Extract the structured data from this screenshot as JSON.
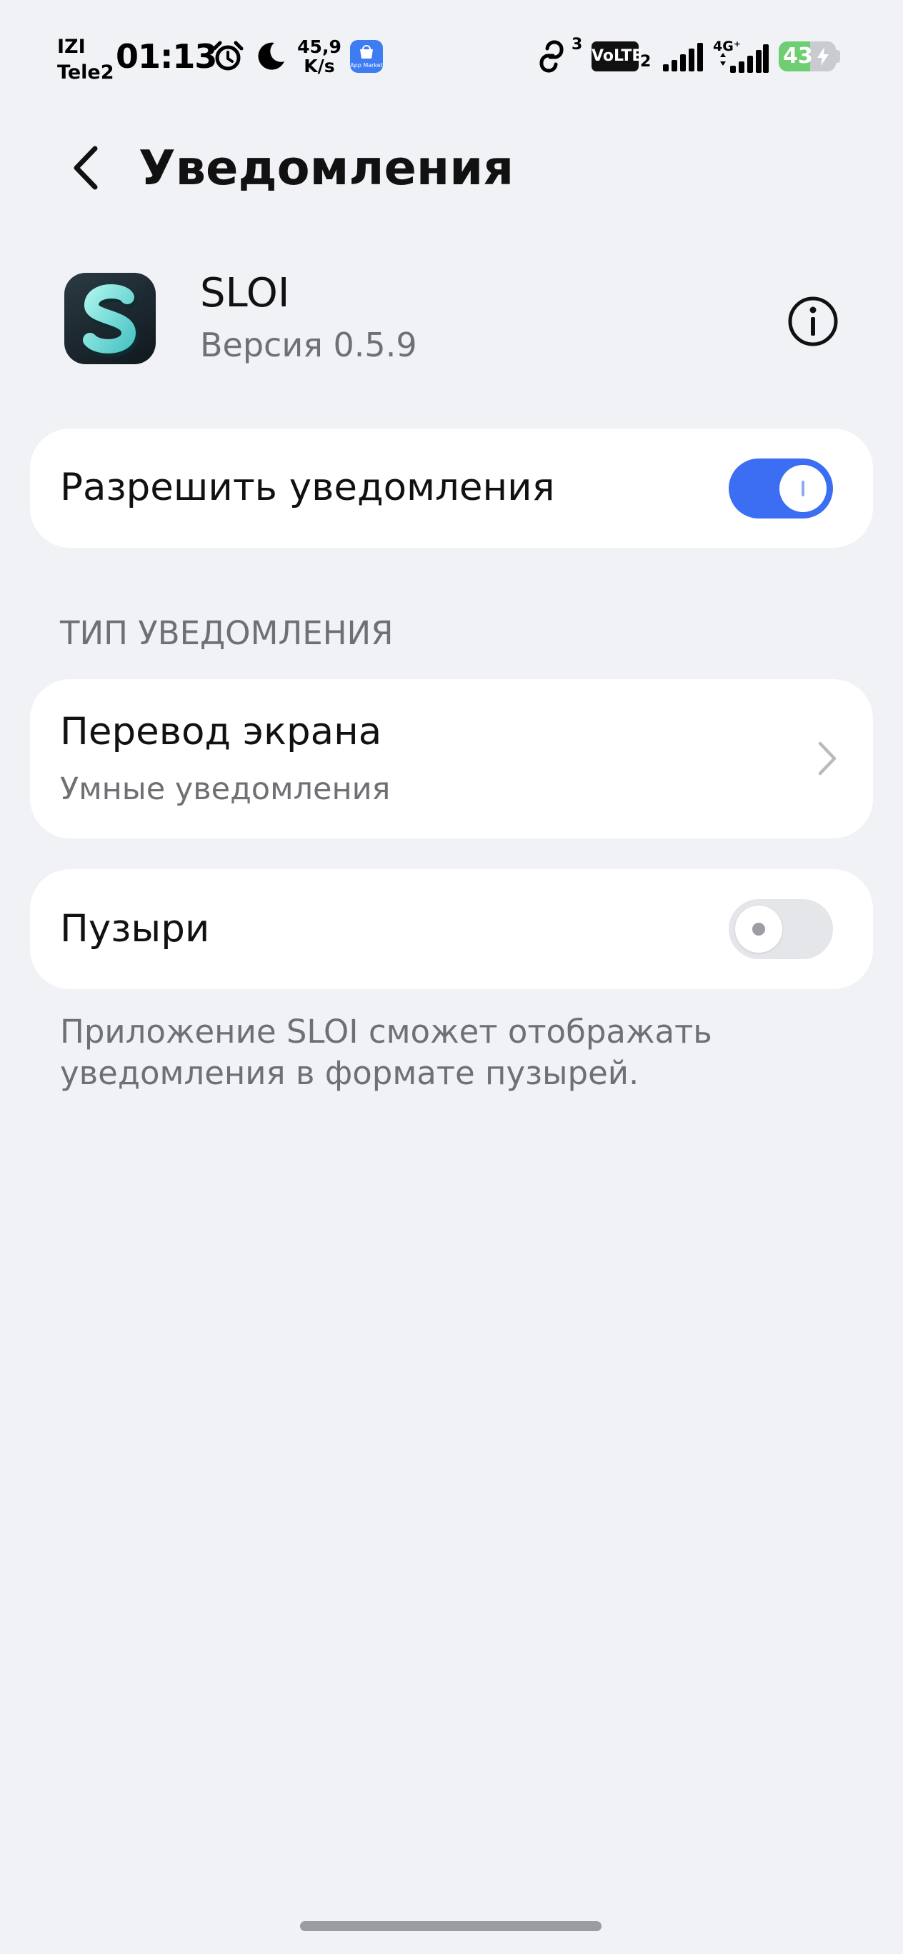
{
  "status_bar": {
    "carrier_top": "IZI",
    "carrier_bottom": "Tele2",
    "time": "01:13",
    "speed_value": "45,9",
    "speed_unit": "K/s",
    "app_market_label": "App Market",
    "sim_number": "3",
    "volte": "VoLTE",
    "volte_sim": "2",
    "network": "4G⁺",
    "battery": "43",
    "icons": [
      "alarm-icon",
      "moon-icon",
      "app-market-icon",
      "hotspot-icon",
      "volte-icon",
      "signal-icon",
      "signal-4g-icon",
      "battery-icon"
    ]
  },
  "header": {
    "title": "Уведомления",
    "back_icon": "chevron-left-icon"
  },
  "app": {
    "name": "SLOI",
    "version": "Версия 0.5.9",
    "icon_letter": "S",
    "info_icon": "info-icon"
  },
  "allow": {
    "label": "Разрешить уведомления",
    "enabled": true
  },
  "section": {
    "title": "ТИП УВЕДОМЛЕНИЯ"
  },
  "channel": {
    "title": "Перевод экрана",
    "subtitle": "Умные уведомления"
  },
  "bubbles": {
    "label": "Пузыри",
    "enabled": false,
    "description": "Приложение SLOI сможет отображать уведомления в формате пузырей."
  },
  "colors": {
    "accent": "#3b6ef3",
    "background": "#f1f2f6",
    "card": "#ffffff",
    "secondary_text": "#6f7073",
    "battery": "#6fcd72"
  }
}
